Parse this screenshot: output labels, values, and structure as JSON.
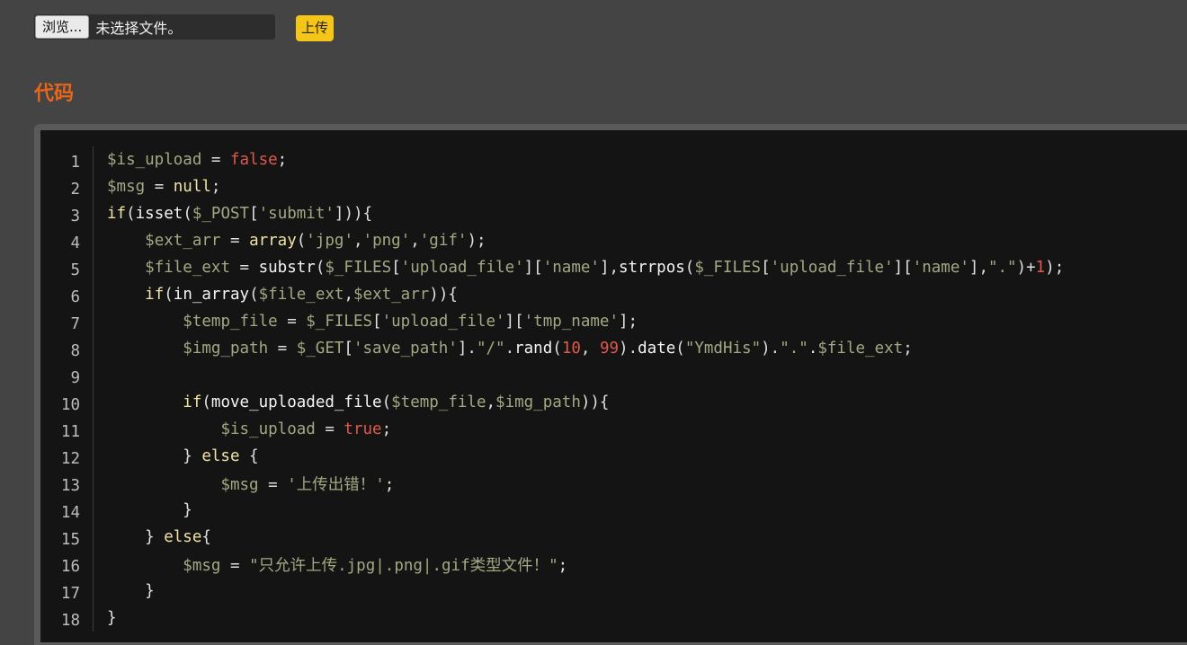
{
  "upload": {
    "browse_label": "浏览...",
    "file_status": "未选择文件。",
    "submit_label": "上传"
  },
  "section_title": "代码",
  "code": {
    "lines": [
      [
        [
          "$is_upload",
          "var"
        ],
        [
          " = ",
          "p"
        ],
        [
          "false",
          "num"
        ],
        [
          ";",
          "p"
        ]
      ],
      [
        [
          "$msg",
          "var"
        ],
        [
          " = ",
          "p"
        ],
        [
          "null",
          "kw"
        ],
        [
          ";",
          "p"
        ]
      ],
      [
        [
          "if",
          "kw"
        ],
        [
          "(",
          "p"
        ],
        [
          "isset",
          "fn"
        ],
        [
          "(",
          "p"
        ],
        [
          "$_POST",
          "var"
        ],
        [
          "[",
          "p"
        ],
        [
          "'submit'",
          "str"
        ],
        [
          "])){",
          "p"
        ]
      ],
      [
        [
          "    ",
          "p"
        ],
        [
          "$ext_arr",
          "var"
        ],
        [
          " = ",
          "p"
        ],
        [
          "array",
          "kw"
        ],
        [
          "(",
          "p"
        ],
        [
          "'jpg'",
          "str"
        ],
        [
          ",",
          "p"
        ],
        [
          "'png'",
          "str"
        ],
        [
          ",",
          "p"
        ],
        [
          "'gif'",
          "str"
        ],
        [
          ");",
          "p"
        ]
      ],
      [
        [
          "    ",
          "p"
        ],
        [
          "$file_ext",
          "var"
        ],
        [
          " = ",
          "p"
        ],
        [
          "substr",
          "fn"
        ],
        [
          "(",
          "p"
        ],
        [
          "$_FILES",
          "var"
        ],
        [
          "[",
          "p"
        ],
        [
          "'upload_file'",
          "str"
        ],
        [
          "][",
          "p"
        ],
        [
          "'name'",
          "str"
        ],
        [
          "],",
          "p"
        ],
        [
          "strrpos",
          "fn"
        ],
        [
          "(",
          "p"
        ],
        [
          "$_FILES",
          "var"
        ],
        [
          "[",
          "p"
        ],
        [
          "'upload_file'",
          "str"
        ],
        [
          "][",
          "p"
        ],
        [
          "'name'",
          "str"
        ],
        [
          "],",
          "p"
        ],
        [
          "\".\"",
          "str"
        ],
        [
          ")+",
          "p"
        ],
        [
          "1",
          "num"
        ],
        [
          ");",
          "p"
        ]
      ],
      [
        [
          "    ",
          "p"
        ],
        [
          "if",
          "kw"
        ],
        [
          "(",
          "p"
        ],
        [
          "in_array",
          "fn"
        ],
        [
          "(",
          "p"
        ],
        [
          "$file_ext",
          "var"
        ],
        [
          ",",
          "p"
        ],
        [
          "$ext_arr",
          "var"
        ],
        [
          ")){",
          "p"
        ]
      ],
      [
        [
          "        ",
          "p"
        ],
        [
          "$temp_file",
          "var"
        ],
        [
          " = ",
          "p"
        ],
        [
          "$_FILES",
          "var"
        ],
        [
          "[",
          "p"
        ],
        [
          "'upload_file'",
          "str"
        ],
        [
          "][",
          "p"
        ],
        [
          "'tmp_name'",
          "str"
        ],
        [
          "];",
          "p"
        ]
      ],
      [
        [
          "        ",
          "p"
        ],
        [
          "$img_path",
          "var"
        ],
        [
          " = ",
          "p"
        ],
        [
          "$_GET",
          "var"
        ],
        [
          "[",
          "p"
        ],
        [
          "'save_path'",
          "str"
        ],
        [
          "].",
          "p"
        ],
        [
          "\"/\"",
          "str"
        ],
        [
          ".",
          "p"
        ],
        [
          "rand",
          "fn"
        ],
        [
          "(",
          "p"
        ],
        [
          "10",
          "num"
        ],
        [
          ", ",
          "p"
        ],
        [
          "99",
          "num"
        ],
        [
          ").",
          "p"
        ],
        [
          "date",
          "fn"
        ],
        [
          "(",
          "p"
        ],
        [
          "\"YmdHis\"",
          "str"
        ],
        [
          ").",
          "p"
        ],
        [
          "\".\"",
          "str"
        ],
        [
          ".",
          "p"
        ],
        [
          "$file_ext",
          "var"
        ],
        [
          ";",
          "p"
        ]
      ],
      [],
      [
        [
          "        ",
          "p"
        ],
        [
          "if",
          "kw"
        ],
        [
          "(",
          "p"
        ],
        [
          "move_uploaded_file",
          "fn"
        ],
        [
          "(",
          "p"
        ],
        [
          "$temp_file",
          "var"
        ],
        [
          ",",
          "p"
        ],
        [
          "$img_path",
          "var"
        ],
        [
          ")){",
          "p"
        ]
      ],
      [
        [
          "            ",
          "p"
        ],
        [
          "$is_upload",
          "var"
        ],
        [
          " = ",
          "p"
        ],
        [
          "true",
          "num"
        ],
        [
          ";",
          "p"
        ]
      ],
      [
        [
          "        } ",
          "p"
        ],
        [
          "else",
          "kw"
        ],
        [
          " {",
          "p"
        ]
      ],
      [
        [
          "            ",
          "p"
        ],
        [
          "$msg",
          "var"
        ],
        [
          " = ",
          "p"
        ],
        [
          "'上传出错！'",
          "str"
        ],
        [
          ";",
          "p"
        ]
      ],
      [
        [
          "        }",
          "p"
        ]
      ],
      [
        [
          "    } ",
          "p"
        ],
        [
          "else",
          "kw"
        ],
        [
          "{",
          "p"
        ]
      ],
      [
        [
          "        ",
          "p"
        ],
        [
          "$msg",
          "var"
        ],
        [
          " = ",
          "p"
        ],
        [
          "\"只允许上传.jpg|.png|.gif类型文件！\"",
          "str"
        ],
        [
          ";",
          "p"
        ]
      ],
      [
        [
          "    }",
          "p"
        ]
      ],
      [
        [
          "}",
          "p"
        ]
      ]
    ]
  }
}
